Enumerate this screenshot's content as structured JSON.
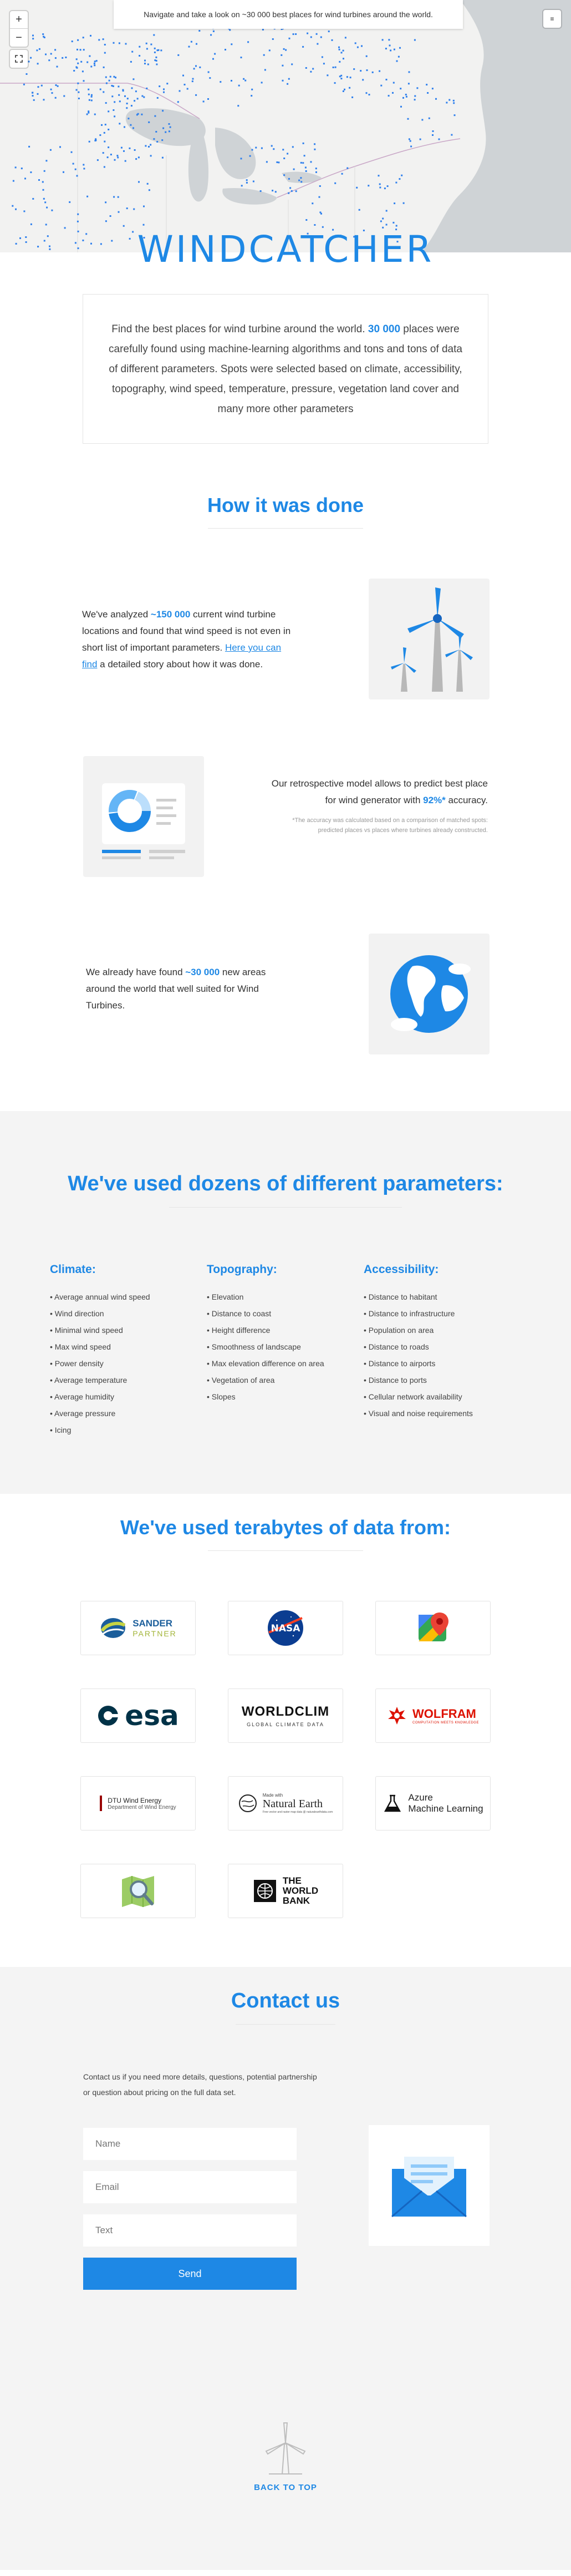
{
  "map": {
    "banner": "Navigate and take a look on ~30 000 best places for wind turbines around the world.",
    "zoom_in": "+",
    "zoom_out": "−",
    "layers_label": "≡"
  },
  "logo": {
    "text": "WINDCATCHER"
  },
  "intro": {
    "part1": "Find the best places for wind turbine around the world. ",
    "accent": "30 000",
    "part2": " places were carefully found using machine-learning algorithms and tons and tons of data of different parameters. Spots were selected based on climate, accessibility, topography, wind speed, temperature, pressure, vegetation land cover and many more other parameters"
  },
  "how": {
    "title": "How it was done",
    "f1": {
      "part1": "We've analyzed ",
      "accent": "~150 000",
      "part2": " current wind turbine locations and found that wind speed is not even in short list of important parameters. ",
      "link": "Here you can find",
      "part3": " a detailed story about how it was done."
    },
    "f2": {
      "part1": "Our retrospective model allows to predict best place for wind generator with ",
      "accent": "92%*",
      "part2": " accuracy.",
      "note": "*The accuracy was calculated based on a comparison of matched spots: predicted places vs places where turbines already constructed."
    },
    "f3": {
      "part1": "We already have found ",
      "accent": "~30 000",
      "part2": " new areas around the world that well suited for Wind Turbines."
    }
  },
  "params": {
    "title": "We've used dozens of different parameters:",
    "columns": [
      {
        "heading": "Climate:",
        "items": [
          "Average annual wind speed",
          "Wind direction",
          "Minimal wind speed",
          "Max wind speed",
          "Power density",
          "Average temperature",
          "Average humidity",
          "Average pressure",
          "Icing"
        ]
      },
      {
        "heading": "Topography:",
        "items": [
          "Elevation",
          "Distance to coast",
          "Height difference",
          "Smoothness of landscape",
          "Max elevation difference on area",
          "Vegetation of area",
          "Slopes"
        ]
      },
      {
        "heading": "Accessibility:",
        "items": [
          "Distance to habitant",
          "Distance to infrastructure",
          "Population on area",
          "Distance to roads",
          "Distance to airports",
          "Distance to ports",
          "Cellular network availability",
          "Visual and noise requirements"
        ]
      }
    ]
  },
  "sources": {
    "title": "We've used terabytes of data from:",
    "sander": {
      "line1": "SANDER",
      "line2": "PARTNER"
    },
    "nasa": "NASA",
    "esa": "esa",
    "worldclim": {
      "line1": "WORLDCLIM",
      "line2": "GLOBAL CLIMATE DATA"
    },
    "wolfram": {
      "line1": "WOLFRAM",
      "line2": "COMPUTATION MEETS KNOWLEDGE"
    },
    "dtu": {
      "line1": "DTU Wind Energy",
      "line2": "Department of Wind Energy"
    },
    "natural_earth": {
      "line1": "Made with",
      "line2": "Natural Earth",
      "line3": "Free vector and raster map data @ naturalearthdata.com"
    },
    "azure": {
      "line1": "Azure",
      "line2": "Machine Learning"
    },
    "world_bank": {
      "line1": "THE",
      "line2": "WORLD",
      "line3": "BANK"
    }
  },
  "contact": {
    "title": "Contact us",
    "intro": "Contact us if you need more details, questions, potential partnership or question about pricing on the full data set.",
    "name_placeholder": "Name",
    "email_placeholder": "Email",
    "text_placeholder": "Text",
    "send_label": "Send",
    "back_to_top": "BACK TO TOP"
  },
  "colors": {
    "accent": "#1e88e5",
    "map_points": "#2f80ed"
  }
}
